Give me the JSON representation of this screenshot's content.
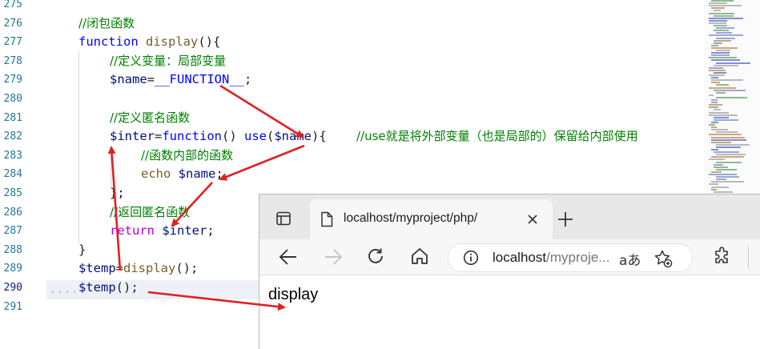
{
  "editor": {
    "line_numbers": [
      "275",
      "276",
      "277",
      "278",
      "279",
      "280",
      "281",
      "282",
      "283",
      "284",
      "285",
      "286",
      "287",
      "288",
      "289",
      "290",
      "291"
    ],
    "lines": {
      "l276": "//闭包函数",
      "l277_kw": "function",
      "l277_fn": "display",
      "l277_rest": "(){",
      "l278": "//定义变量：局部变量",
      "l279_var": "$name",
      "l279_eq": "=",
      "l279_const": "__FUNCTION__",
      "l279_semi": ";",
      "l281": "//定义匿名函数",
      "l282_var": "$inter",
      "l282_eq": "=",
      "l282_kw": "function",
      "l282_p": "() ",
      "l282_use": "use",
      "l282_p2": "(",
      "l282_var2": "$name",
      "l282_p3": "){",
      "l282_cmt": "//use就是将外部变量（也是局部的）保留给内部使用",
      "l283": "//函数内部的函数",
      "l284_kw": "echo",
      "l284_var": "$name",
      "l284_semi": ";",
      "l285": "};",
      "l286": "//返回匿名函数",
      "l287_kw": "return",
      "l287_var": "$inter",
      "l287_semi": ";",
      "l288": "}",
      "l289_var": "$temp",
      "l289_eq": "=",
      "l289_fn": "display",
      "l289_rest": "();",
      "l290_var": "$temp",
      "l290_rest": "();"
    },
    "colors": {
      "line_number": "#237893",
      "keyword": "#0000ff",
      "function": "#795e26",
      "variable": "#001080",
      "comment": "#008000",
      "control": "#af00db",
      "annotation_arrow": "#e02020"
    }
  },
  "browser": {
    "tab_title": "localhost/myproject/php/",
    "address_host": "localhost",
    "address_rest": "/myproje...",
    "read_aloud_label": "aあ",
    "page_output": "display",
    "icons": [
      "tab-actions-icon",
      "page-icon",
      "close-icon",
      "new-tab-icon",
      "back-icon",
      "forward-icon",
      "refresh-icon",
      "home-icon",
      "info-icon",
      "read-aloud-icon",
      "add-favorite-icon",
      "extensions-icon"
    ]
  }
}
